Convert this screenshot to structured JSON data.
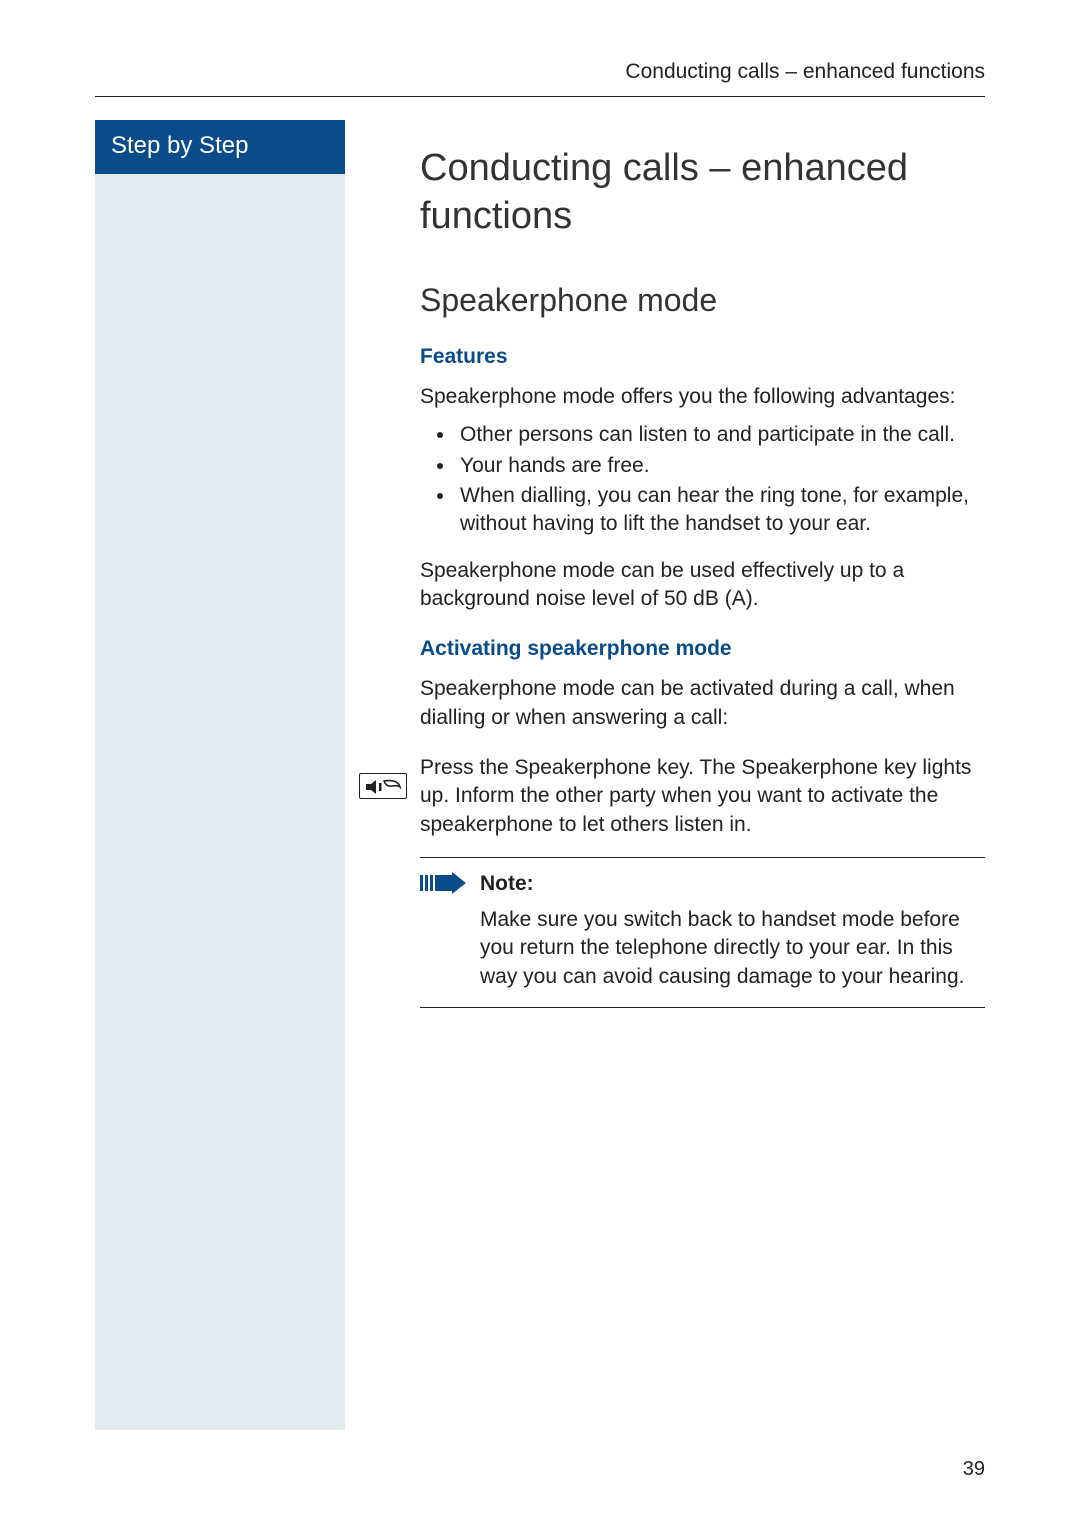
{
  "header": {
    "running_title": "Conducting calls – enhanced functions"
  },
  "sidebar": {
    "label": "Step by Step"
  },
  "main": {
    "title": "Conducting calls – enhanced functions",
    "subtitle": "Speakerphone mode",
    "features": {
      "heading": "Features",
      "intro": "Speakerphone mode offers you the following advantages:",
      "bullets": [
        "Other persons can listen to and participate in the call.",
        "Your hands are free.",
        "When dialling, you can hear the ring tone, for example, without having to lift the handset to your ear."
      ],
      "noise": "Speakerphone mode can be used effectively up to a background noise level of 50 dB (A)."
    },
    "activating": {
      "heading": "Activating speakerphone mode",
      "intro": "Speakerphone mode can be activated during a call, when dialling or when answering a call:",
      "step": "Press the Speakerphone key. The Speakerphone key lights up. Inform the other party when you want to activate the speakerphone to let others listen in."
    },
    "note": {
      "label": "Note:",
      "body": "Make sure you switch back to handset mode before you return the telephone directly to your ear. In this way you can avoid causing damage to your hearing."
    }
  },
  "page_number": "39"
}
